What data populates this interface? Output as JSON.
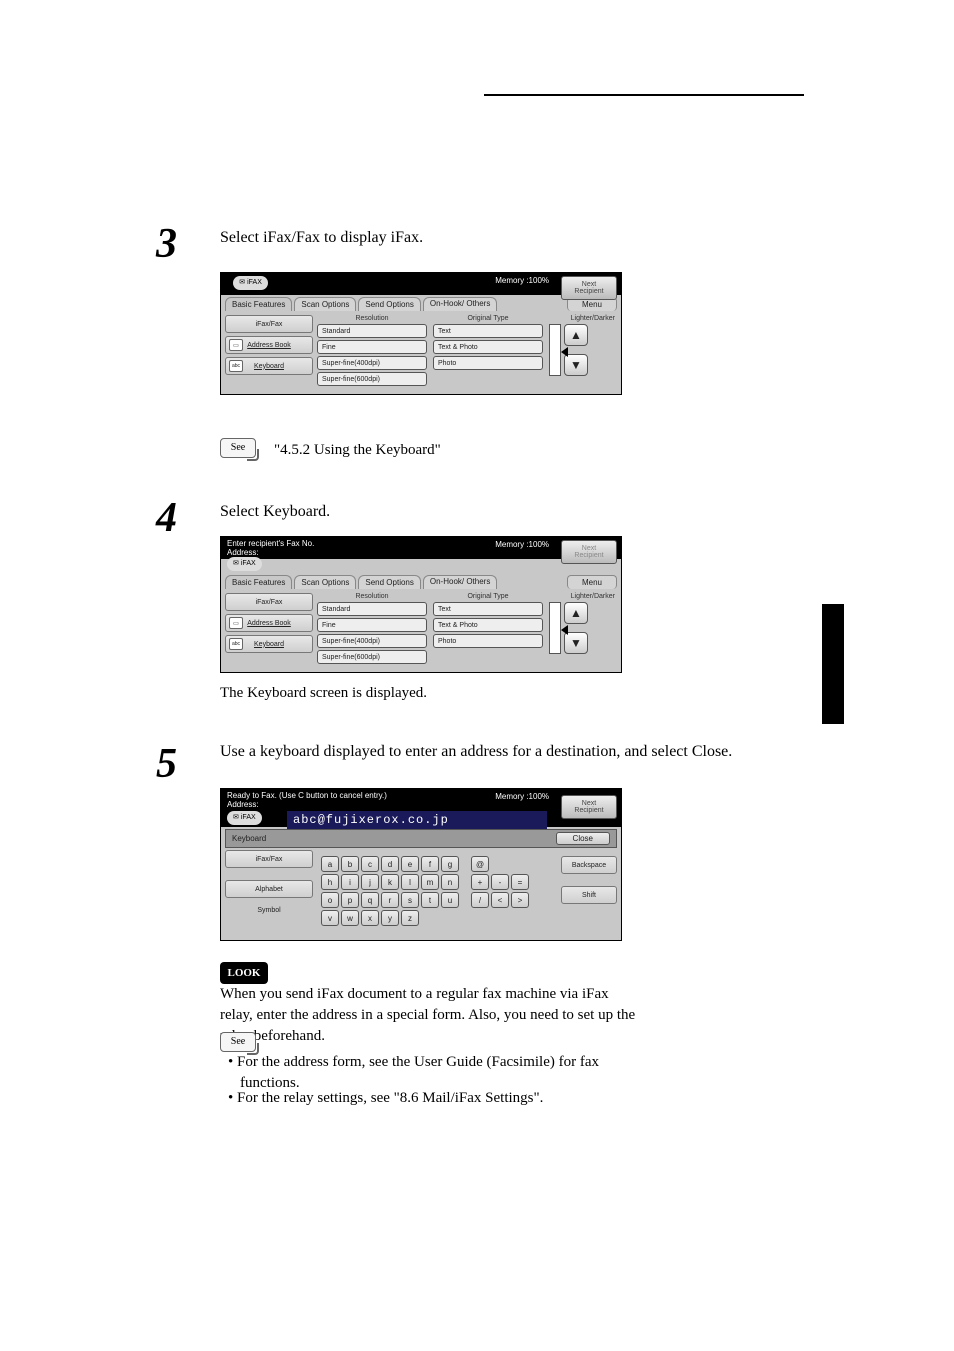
{
  "doc": {
    "step3": "3",
    "step4": "4",
    "step5": "5",
    "step3_text": "Select iFax/Fax to display iFax.",
    "step4_text": "Select Keyboard.",
    "step5_text": "Use a keyboard displayed to enter an address for a destination, and select Close.",
    "keyboard_displayed": "The Keyboard screen is displayed.",
    "see_label": "See",
    "look_label": "LOOK",
    "see1": "\"4.5.2 Using the Keyboard\"",
    "look_text": "When you send iFax document to a regular fax machine via iFax relay, enter the address in a special form. Also, you need to set up the relay beforehand.",
    "see2a": "For the address form, see the User Guide (Facsimile) for fax functions.",
    "see2b": "For the relay settings, see \"8.6 Mail/iFax Settings\"."
  },
  "panel1": {
    "ifax_pill": "iFAX",
    "memory": "Memory :100%",
    "next1": "Next",
    "next2": "Recipient",
    "tabs": {
      "basic": "Basic Features",
      "scan": "Scan Options",
      "send": "Send Options",
      "onhook": "On-Hook/\nOthers",
      "menu": "Menu"
    },
    "side": {
      "ifaxfax": "iFax/Fax",
      "addrbook": "Address Book",
      "keyboard": "Keyboard"
    },
    "heads": {
      "resolution": "Resolution",
      "original": "Original Type",
      "lighten": "Lighter/Darker"
    },
    "res": [
      "Standard",
      "Fine",
      "Super-fine(400dpi)",
      "Super-fine(600dpi)"
    ],
    "origtype": [
      "Text",
      "Text & Photo",
      "Photo"
    ]
  },
  "panel2": {
    "status": "Enter recipient's Fax No.",
    "addr_label": "Address:",
    "ifax_pill": "iFAX"
  },
  "panel3": {
    "status": "Ready to Fax. (Use C button to cancel entry.)",
    "addr_label": "Address:",
    "addr_value": "abc@fujixerox.co.jp",
    "header": "Keyboard",
    "close": "Close",
    "backspace": "Backspace",
    "shift": "Shift",
    "side_ifaxfax": "iFax/Fax",
    "side_alphabet": "Alphabet",
    "side_symbol": "Symbol",
    "row1": [
      "a",
      "b",
      "c",
      "d",
      "e",
      "f",
      "g"
    ],
    "row1b": [
      "@"
    ],
    "row2": [
      "h",
      "i",
      "j",
      "k",
      "l",
      "m",
      "n"
    ],
    "row2b": [
      "+",
      "-",
      "="
    ],
    "row3": [
      "o",
      "p",
      "q",
      "r",
      "s",
      "t",
      "u"
    ],
    "row3b": [
      "/",
      "<",
      ">"
    ],
    "row4": [
      "v",
      "w",
      "x",
      "y",
      "z"
    ]
  }
}
